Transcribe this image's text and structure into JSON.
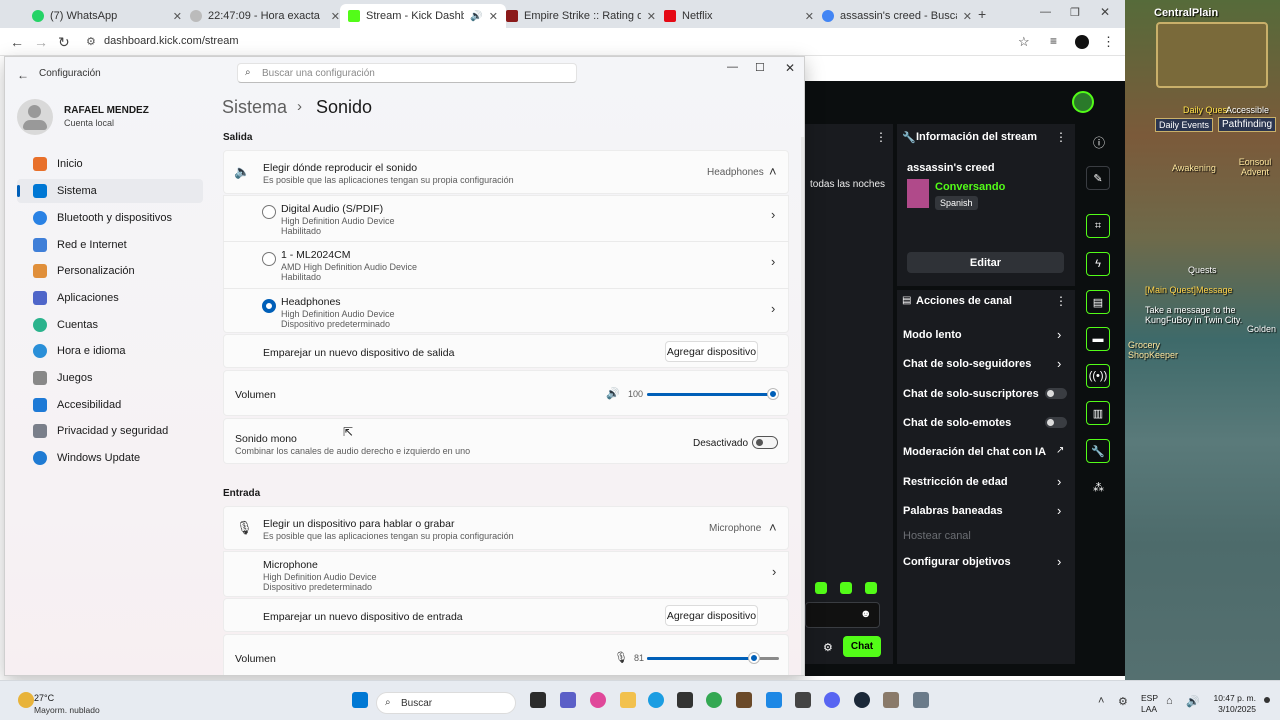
{
  "browser": {
    "tabs": [
      {
        "title": "(7) WhatsApp",
        "color": "#25d366"
      },
      {
        "title": "22:47:09 - Hora exacta",
        "color": "#999999"
      },
      {
        "title": "Stream - Kick Dashboard",
        "color": "#53fc18"
      },
      {
        "title": "Empire Strike :: Rating de clan",
        "color": "#8b1a1a"
      },
      {
        "title": "Netflix",
        "color": "#e50914"
      },
      {
        "title": "assassin's creed - Buscar con G",
        "color": "#4285f4"
      }
    ],
    "url": "dashboard.kick.com/stream"
  },
  "settings": {
    "app_title": "Configuración",
    "search_placeholder": "Buscar una configuración",
    "user_name": "RAFAEL MENDEZ",
    "user_type": "Cuenta local",
    "breadcrumb_parent": "Sistema",
    "breadcrumb_sep": "›",
    "page_title": "Sonido",
    "nav": [
      {
        "label": "Inicio",
        "color": "#e8702a"
      },
      {
        "label": "Sistema",
        "color": "#0078d4"
      },
      {
        "label": "Bluetooth y dispositivos",
        "color": "#2a82e4"
      },
      {
        "label": "Red e Internet",
        "color": "#3f7fd8"
      },
      {
        "label": "Personalización",
        "color": "#e08f3a"
      },
      {
        "label": "Aplicaciones",
        "color": "#4f66c9"
      },
      {
        "label": "Cuentas",
        "color": "#2bb38d"
      },
      {
        "label": "Hora e idioma",
        "color": "#2a8fd8"
      },
      {
        "label": "Juegos",
        "color": "#888888"
      },
      {
        "label": "Accesibilidad",
        "color": "#1e7ad6"
      },
      {
        "label": "Privacidad y seguridad",
        "color": "#7a7f8a"
      },
      {
        "label": "Windows Update",
        "color": "#1f7bd3"
      }
    ],
    "output_section": "Salida",
    "output_choose_title": "Elegir dónde reproducir el sonido",
    "output_choose_sub": "Es posible que las aplicaciones tengan su propia configuración",
    "output_current": "Headphones",
    "output_devices": [
      {
        "name": "Digital Audio (S/PDIF)",
        "driver": "High Definition Audio Device",
        "status": "Habilitado",
        "selected": false
      },
      {
        "name": "1 - ML2024CM",
        "driver": "AMD High Definition Audio Device",
        "status": "Habilitado",
        "selected": false
      },
      {
        "name": "Headphones",
        "driver": "High Definition Audio Device",
        "status": "Dispositivo predeterminado",
        "selected": true
      }
    ],
    "pair_output_label": "Emparejar un nuevo dispositivo de salida",
    "add_device_label": "Agregar dispositivo",
    "volume_label": "Volumen",
    "output_volume": "100",
    "mono_title": "Sonido mono",
    "mono_sub": "Combinar los canales de audio derecho e izquierdo en uno",
    "mono_state": "Desactivado",
    "input_section": "Entrada",
    "input_choose_title": "Elegir un dispositivo para hablar o grabar",
    "input_choose_sub": "Es posible que las aplicaciones tengan su propia configuración",
    "input_current": "Microphone",
    "input_device": {
      "name": "Microphone",
      "driver": "High Definition Audio Device",
      "status": "Dispositivo predeterminado"
    },
    "pair_input_label": "Emparejar un nuevo dispositivo de entrada",
    "input_volume": "81",
    "output_volume_fraction": 1.0,
    "input_volume_fraction": 0.81
  },
  "kick": {
    "left_text": "todas las noches",
    "info_title": "Información del stream",
    "stream_title": "assassin's creed",
    "category": "Conversando",
    "language": "Spanish",
    "edit_button": "Editar",
    "actions_title": "Acciones de canal",
    "actions": [
      {
        "label": "Modo lento",
        "control": "chevron"
      },
      {
        "label": "Chat de solo-seguidores",
        "control": "chevron"
      },
      {
        "label": "Chat de solo-suscriptores",
        "control": "toggle"
      },
      {
        "label": "Chat de solo-emotes",
        "control": "toggle"
      },
      {
        "label": "Moderación del chat con IA",
        "control": "external"
      },
      {
        "label": "Restricción de edad",
        "control": "chevron"
      },
      {
        "label": "Palabras baneadas",
        "control": "chevron"
      },
      {
        "label": "Hostear canal",
        "control": "none"
      },
      {
        "label": "Configurar objetivos",
        "control": "chevron"
      }
    ],
    "chat_button": "Chat",
    "accent": "#53fc18"
  },
  "game": {
    "map_name": "CentralPlain",
    "daily_quest": "Daily Quest",
    "accessible": "Accessible",
    "daily_events": "Daily Events",
    "pathfinding": "Pathfinding",
    "awakening": "Awakening",
    "eonsoul": "Eonsoul Advent",
    "quests": "Quests",
    "main_quest": "[Main Quest]Message",
    "quest_text": "Take a message to the KungFuBoy in Twin City.",
    "golden": "Golden",
    "grocery": "Grocery ShopKeeper"
  },
  "taskbar": {
    "weather_temp": "27°C",
    "weather_desc": "Mayorm. nublado",
    "search_label": "Buscar",
    "lang": "ESP",
    "lang2": "LAA",
    "time": "10:47 p. m.",
    "date": "3/10/2025"
  }
}
